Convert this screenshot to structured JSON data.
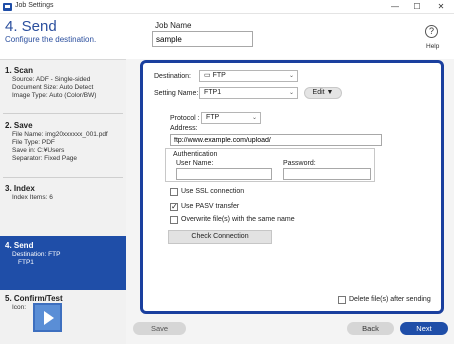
{
  "window": {
    "title": "Job Settings",
    "minimize": "—",
    "maximize": "☐",
    "close": "✕"
  },
  "header": {
    "step_title": "4. Send",
    "step_subtitle": "Configure the destination.",
    "job_name_label": "Job Name",
    "job_name_value": "sample",
    "help_icon": "?",
    "help_label": "Help"
  },
  "sidebar": {
    "scan": {
      "title": "1. Scan",
      "lines": [
        "Source: ADF - Single-sided",
        "Document Size: Auto Detect",
        "Image Type: Auto (Color/BW)"
      ]
    },
    "save": {
      "title": "2. Save",
      "lines": [
        "File Name: img20xxxxxx_001.pdf",
        "File Type: PDF",
        "Save in: C:¥Users",
        "Separator: Fixed Page"
      ]
    },
    "index": {
      "title": "3. Index",
      "lines": [
        "Index Items: 6"
      ]
    },
    "send": {
      "title": "4. Send",
      "lines": [
        "Destination: FTP",
        "FTP1"
      ]
    },
    "confirm": {
      "title": "5. Confirm/Test",
      "lines": [
        "Icon:"
      ]
    }
  },
  "panel": {
    "destination_label": "Destination:",
    "destination_value": "FTP",
    "setting_name_label": "Setting Name:",
    "setting_name_value": "FTP1",
    "edit_button": "Edit ▼",
    "protocol_label": "Protocol :",
    "protocol_value": "FTP",
    "address_label": "Address:",
    "address_value": "ftp://www.example.com/upload/",
    "auth_title": "Authentication",
    "user_name_label": "User Name:",
    "user_name_value": "",
    "password_label": "Password:",
    "password_value": "",
    "ssl_label": "Use SSL connection",
    "ssl_checked": false,
    "pasv_label": "Use PASV transfer",
    "pasv_checked": true,
    "overwrite_label": "Overwrite file(s) with the same name",
    "overwrite_checked": false,
    "check_connection_button": "Check Connection",
    "delete_label": "Delete file(s) after sending",
    "delete_checked": false
  },
  "footer": {
    "save": "Save",
    "back": "Back",
    "next": "Next"
  },
  "colors": {
    "accent": "#1f4ea8",
    "panel_border": "#1a3f9e",
    "title_blue": "#2b4f9e"
  }
}
